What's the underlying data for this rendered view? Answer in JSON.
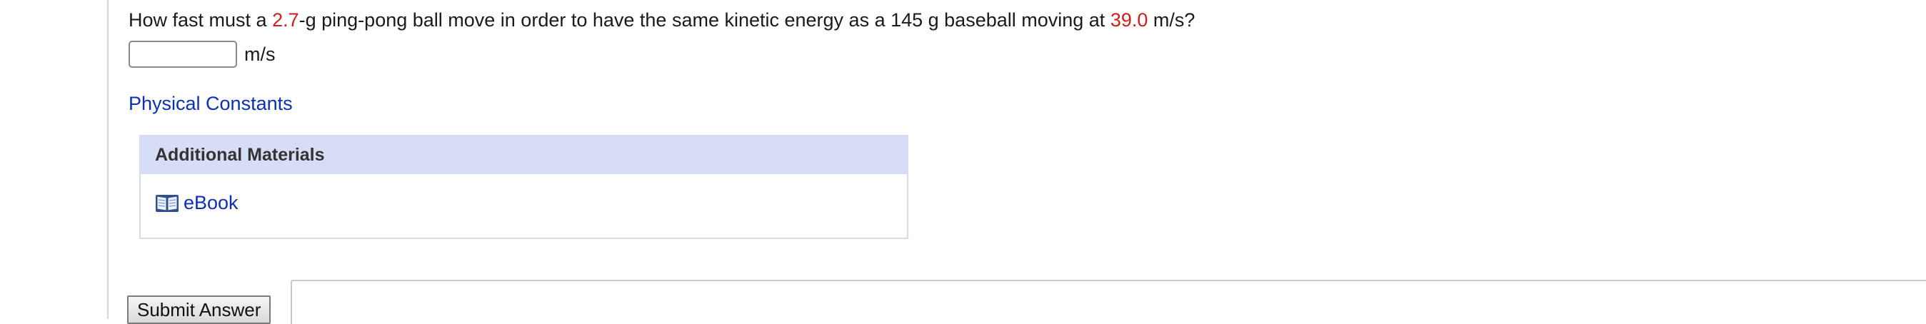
{
  "question": {
    "prefix": "How fast must a ",
    "mass_value": "2.7",
    "middle": "-g ping-pong ball move in order to have the same kinetic energy as a 145 g baseball moving at ",
    "speed_value": "39.0",
    "suffix": " m/s?"
  },
  "answer": {
    "value": "",
    "unit": "m/s"
  },
  "links": {
    "physical_constants": "Physical Constants"
  },
  "additional_materials": {
    "header": "Additional Materials",
    "items": [
      {
        "label": "eBook",
        "icon": "book-icon"
      }
    ]
  },
  "actions": {
    "submit_label": "Submit Answer"
  },
  "colors": {
    "highlight_value": "#cc1f1f",
    "link": "#0b2fb7",
    "materials_header_bg": "#d7ddf4"
  }
}
